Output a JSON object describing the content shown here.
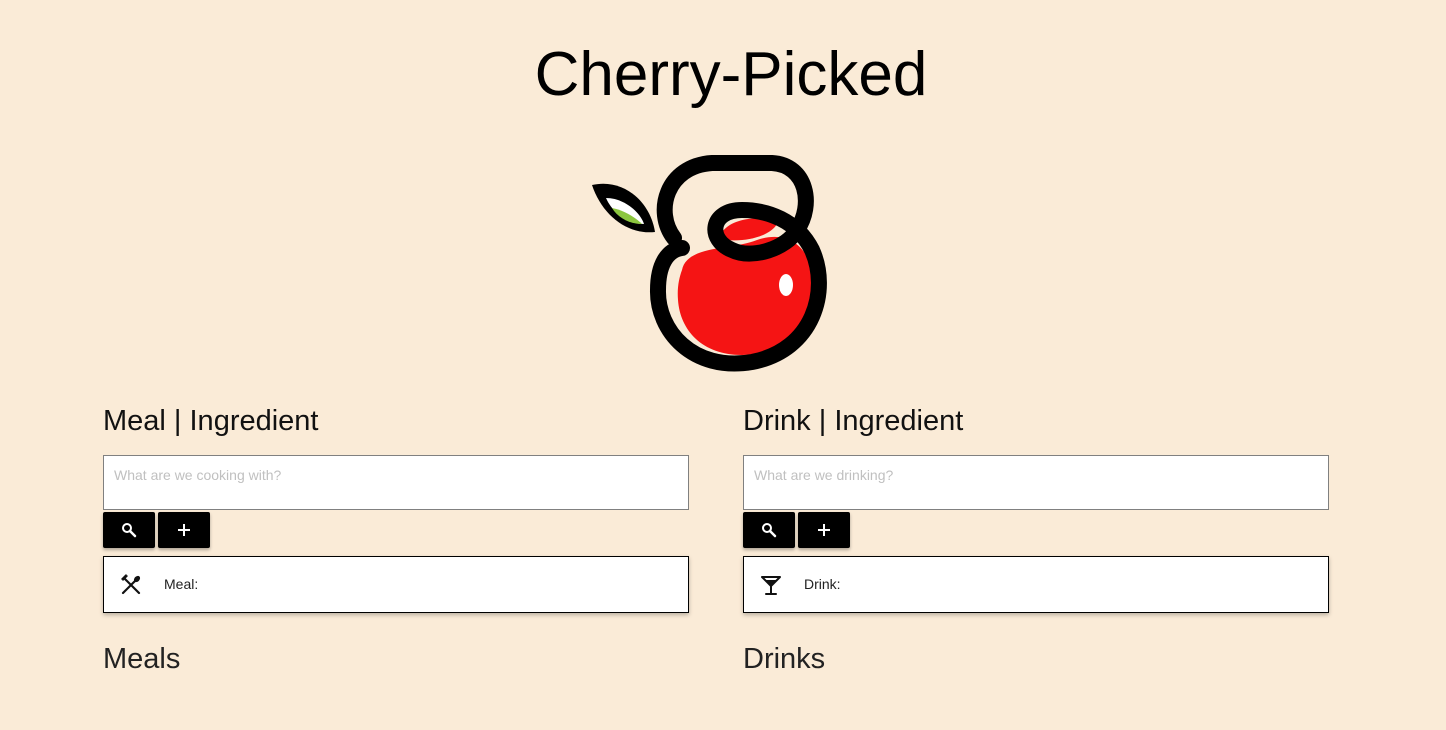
{
  "app": {
    "title": "Cherry-Picked",
    "logo_icon": "cherry-logo-icon"
  },
  "colors": {
    "background": "#faebd7",
    "button": "#000000",
    "cherry_red": "#f51414",
    "leaf_green": "#8cc63f"
  },
  "meal": {
    "heading": "Meal | Ingredient",
    "search_placeholder": "What are we cooking with?",
    "search_button_icon": "search-icon",
    "add_button_icon": "plus-icon",
    "card_icon": "fork-spoon-icon",
    "card_label": "Meal:",
    "list_heading": "Meals"
  },
  "drink": {
    "heading": "Drink | Ingredient",
    "search_placeholder": "What are we drinking?",
    "search_button_icon": "search-icon",
    "add_button_icon": "plus-icon",
    "card_icon": "cocktail-glass-icon",
    "card_label": "Drink:",
    "list_heading": "Drinks"
  }
}
